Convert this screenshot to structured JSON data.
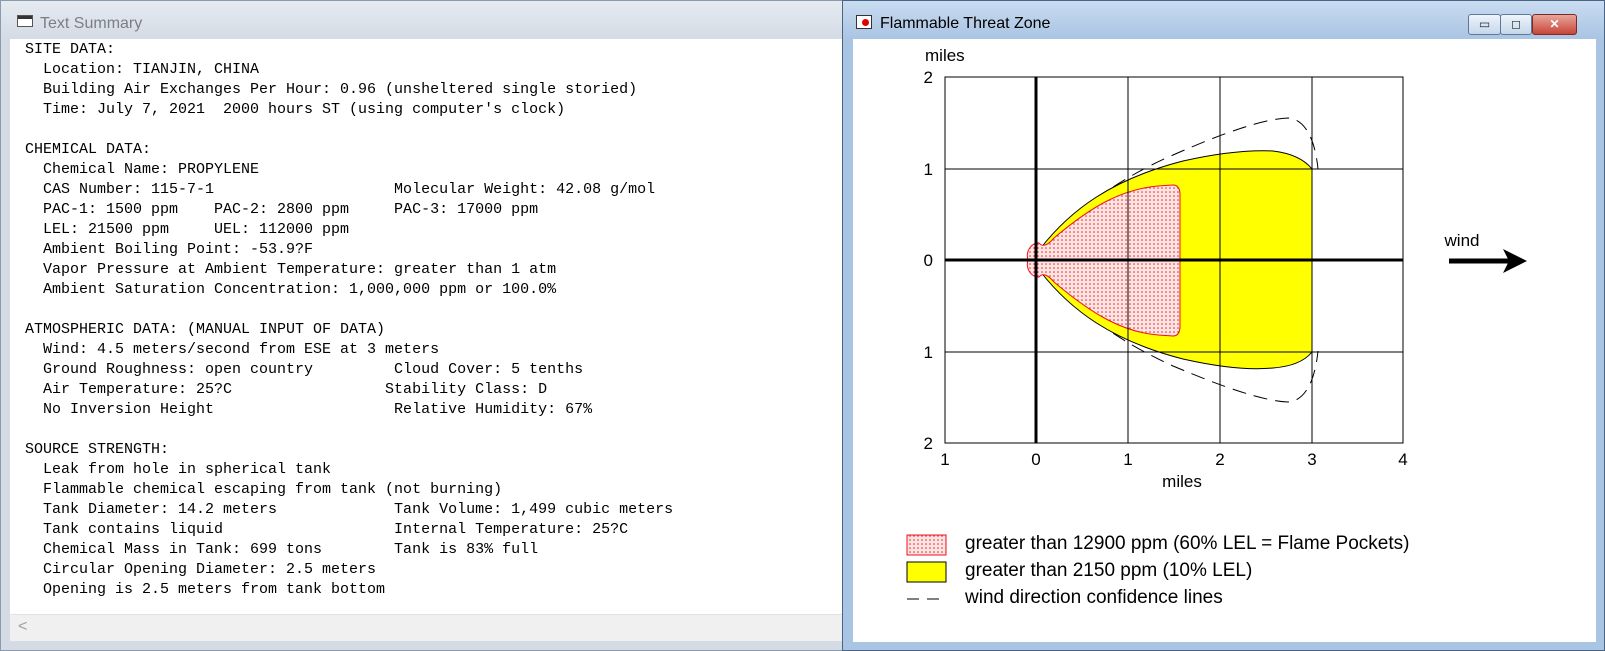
{
  "left_window": {
    "title": "Text Summary",
    "scroll_left_arrow": "<",
    "lines": [
      "SITE DATA:",
      "  Location: TIANJIN, CHINA",
      "  Building Air Exchanges Per Hour: 0.96 (unsheltered single storied)",
      "  Time: July 7, 2021  2000 hours ST (using computer's clock)",
      "",
      "CHEMICAL DATA:",
      "  Chemical Name: PROPYLENE",
      "  CAS Number: 115-7-1                    Molecular Weight: 42.08 g/mol",
      "  PAC-1: 1500 ppm    PAC-2: 2800 ppm     PAC-3: 17000 ppm",
      "  LEL: 21500 ppm     UEL: 112000 ppm",
      "  Ambient Boiling Point: -53.9?F",
      "  Vapor Pressure at Ambient Temperature: greater than 1 atm",
      "  Ambient Saturation Concentration: 1,000,000 ppm or 100.0%",
      "",
      "ATMOSPHERIC DATA: (MANUAL INPUT OF DATA)",
      "  Wind: 4.5 meters/second from ESE at 3 meters",
      "  Ground Roughness: open country         Cloud Cover: 5 tenths",
      "  Air Temperature: 25?C                 Stability Class: D",
      "  No Inversion Height                    Relative Humidity: 67%",
      "",
      "SOURCE STRENGTH:",
      "  Leak from hole in spherical tank",
      "  Flammable chemical escaping from tank (not burning)",
      "  Tank Diameter: 14.2 meters             Tank Volume: 1,499 cubic meters",
      "  Tank contains liquid                   Internal Temperature: 25?C",
      "  Chemical Mass in Tank: 699 tons        Tank is 83% full",
      "  Circular Opening Diameter: 2.5 meters",
      "  Opening is 2.5 meters from tank bottom"
    ]
  },
  "right_window": {
    "title": "Flammable Threat Zone",
    "buttons": {
      "minimize": "▭",
      "maximize": "◻",
      "close": "✕"
    },
    "plot": {
      "y_unit_label": "miles",
      "x_unit_label": "miles",
      "x_ticks": [
        "1",
        "0",
        "1",
        "2",
        "3",
        "4"
      ],
      "y_ticks": [
        "2",
        "1",
        "0",
        "1",
        "2"
      ],
      "x_range": [
        -1,
        4
      ],
      "y_range": [
        -2,
        2
      ],
      "wind_label": "wind",
      "zones": {
        "red_edge": "#e8141b",
        "red_fill": "#ffe4e4",
        "yellow_fill": "#ffff00",
        "red_extent_miles": 1.55,
        "yellow_extent_miles": 3.0
      },
      "legend": [
        {
          "swatch": "red-dotted",
          "label": "greater than 12900 ppm (60% LEL = Flame Pockets)"
        },
        {
          "swatch": "yellow",
          "label": "greater than 2150 ppm (10% LEL)"
        },
        {
          "swatch": "dashed",
          "label": "wind direction confidence lines"
        }
      ]
    }
  }
}
